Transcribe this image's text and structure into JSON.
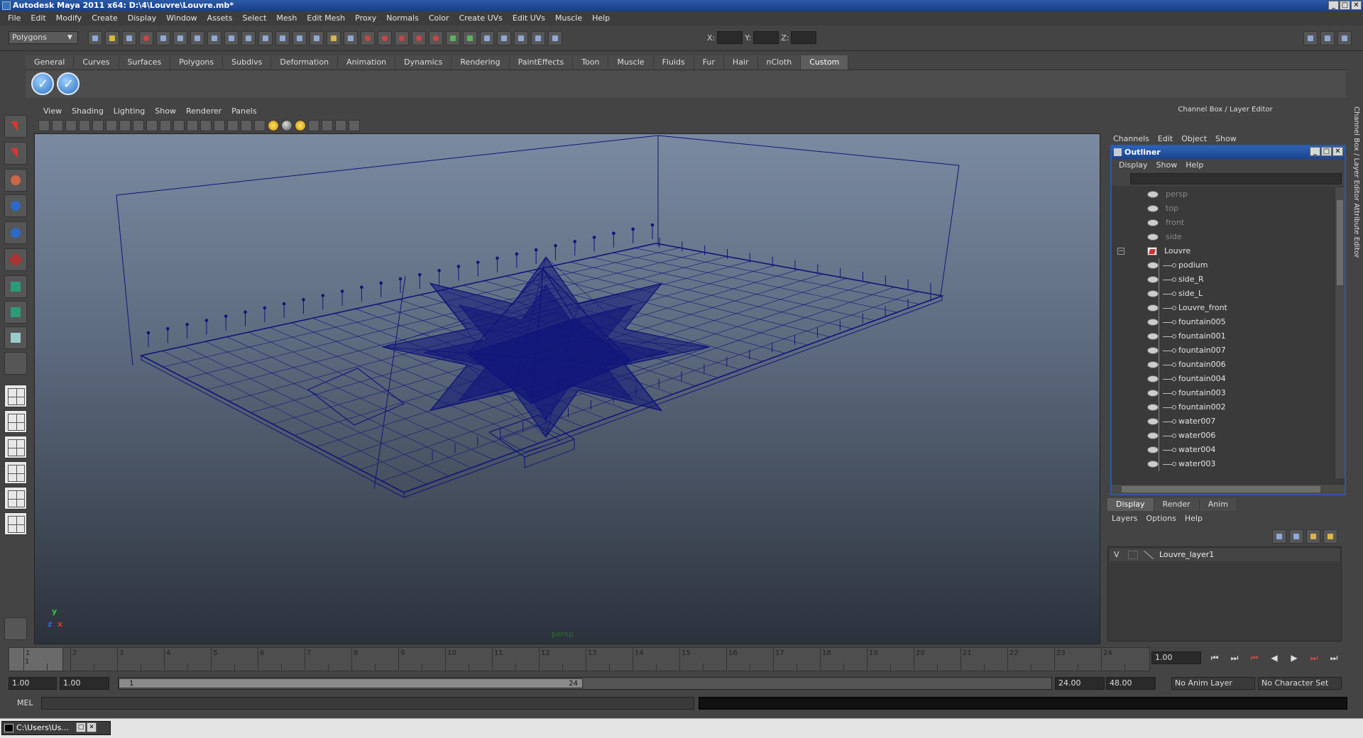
{
  "window": {
    "title": "Autodesk Maya 2011 x64: D:\\4\\Louvre\\Louvre.mb*"
  },
  "window_buttons": [
    "_",
    "□",
    "✕"
  ],
  "menubar": [
    "File",
    "Edit",
    "Modify",
    "Create",
    "Display",
    "Window",
    "Assets",
    "Select",
    "Mesh",
    "Edit Mesh",
    "Proxy",
    "Normals",
    "Color",
    "Create UVs",
    "Edit UVs",
    "Muscle",
    "Help"
  ],
  "status_line": {
    "mode": "Polygons",
    "x_label": "X:",
    "y_label": "Y:",
    "z_label": "Z:"
  },
  "shelf_tabs": [
    "General",
    "Curves",
    "Surfaces",
    "Polygons",
    "Subdivs",
    "Deformation",
    "Animation",
    "Dynamics",
    "Rendering",
    "PaintEffects",
    "Toon",
    "Muscle",
    "Fluids",
    "Fur",
    "Hair",
    "nCloth",
    "Custom"
  ],
  "shelf_active": "Custom",
  "shelf_button_glyph": "✓",
  "viewport": {
    "menu": [
      "View",
      "Shading",
      "Lighting",
      "Show",
      "Renderer",
      "Panels"
    ],
    "camera": "persp",
    "axis": {
      "y": "y",
      "x": "x",
      "z": "z"
    }
  },
  "channel_box": {
    "title": "Channel Box / Layer Editor",
    "menu": [
      "Channels",
      "Edit",
      "Object",
      "Show"
    ]
  },
  "side_tabs": "Channel Box / Layer Editor     Attribute Editor",
  "outliner": {
    "title": "Outliner",
    "menu": [
      "Display",
      "Show",
      "Help"
    ],
    "collapse_glyph": "−",
    "cameras": [
      "persp",
      "top",
      "front",
      "side"
    ],
    "group": "Louvre",
    "children": [
      "podium",
      "side_R",
      "side_L",
      "Louvre_front",
      "fountain005",
      "fountain001",
      "fountain007",
      "fountain006",
      "fountain004",
      "fountain003",
      "fountain002",
      "water007",
      "water006",
      "water004",
      "water003"
    ]
  },
  "layer_editor": {
    "tabs": [
      "Display",
      "Render",
      "Anim"
    ],
    "active_tab": "Display",
    "menu": [
      "Layers",
      "Options",
      "Help"
    ],
    "layers": [
      {
        "visible": "V",
        "name": "Louvre_layer1"
      }
    ]
  },
  "time_slider": {
    "ticks": [
      "1",
      "2",
      "3",
      "4",
      "5",
      "6",
      "7",
      "8",
      "9",
      "10",
      "11",
      "12",
      "13",
      "14",
      "15",
      "16",
      "17",
      "18",
      "19",
      "20",
      "21",
      "22",
      "23",
      "24"
    ],
    "current_frame_label": "1",
    "current_frame_field": "1.00"
  },
  "playback_buttons": [
    "⏮",
    "⏭",
    "⏮",
    "◀",
    "▶",
    "⏭",
    "⏭"
  ],
  "range": {
    "start": "1.00",
    "playback_start": "1.00",
    "slider_start": "1",
    "slider_end": "24",
    "playback_end": "24.00",
    "end": "48.00",
    "anim_layer": "No Anim Layer",
    "character_set": "No Character Set"
  },
  "command_line": {
    "label": "MEL"
  },
  "taskbar": {
    "item": "C:\\Users\\Us..."
  },
  "colors": {
    "wireframe": "#10157a",
    "title_blue": "#2a5aa8",
    "viewport_top": "#7a8aa0",
    "viewport_bottom": "#2c323c"
  }
}
